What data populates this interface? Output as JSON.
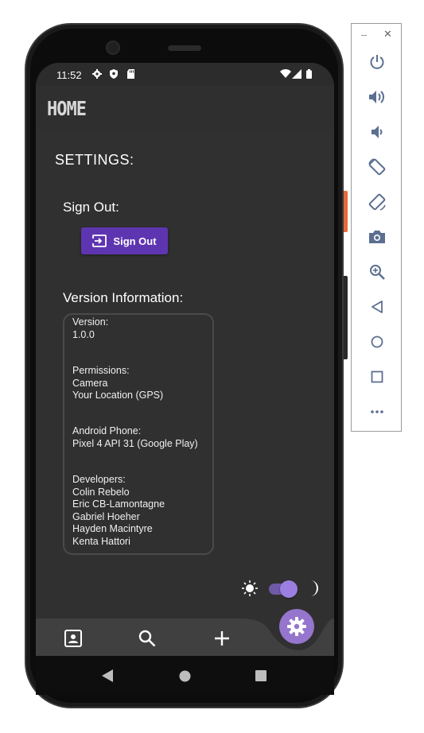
{
  "status_bar": {
    "time": "11:52"
  },
  "app_bar": {
    "title": "HOME"
  },
  "settings": {
    "title": "SETTINGS:",
    "sign_out_label": "Sign Out:",
    "sign_out_button": "Sign Out",
    "version_label": "Version Information:",
    "info": {
      "version_heading": "Version:",
      "version_value": "1.0.0",
      "permissions_heading": "Permissions:",
      "permissions": [
        "Camera",
        "Your Location (GPS)"
      ],
      "phone_heading": "Android Phone:",
      "phone_value": "Pixel 4 API 31 (Google Play)",
      "developers_heading": "Developers:",
      "developers": [
        "Colin Rebelo",
        "Eric CB-Lamontagne",
        "Gabriel Hoeher",
        "Hayden Macintyre",
        "Kenta Hattori"
      ]
    }
  },
  "theme_toggle": {
    "dark_mode": true
  },
  "bottom_nav": {
    "items": [
      "contacts-icon",
      "search-icon",
      "add-icon"
    ],
    "fab": "settings-gear-icon"
  },
  "colors": {
    "accent": "#5e35b1",
    "fab": "#9575cd",
    "background": "#303030"
  }
}
